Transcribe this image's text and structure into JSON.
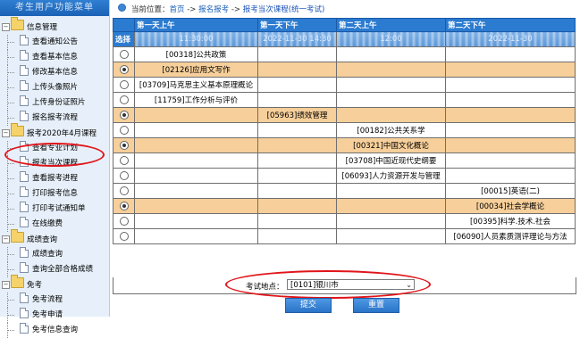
{
  "sidebar": {
    "title": "考生用户功能菜单",
    "groups": [
      {
        "label": "信息管理",
        "items": [
          "查看通知公告",
          "查看基本信息",
          "修改基本信息",
          "上传头像照片",
          "上传身份证照片",
          "报名报考流程"
        ]
      },
      {
        "label": "报考2020年4月课程",
        "items": [
          "查看专业计划",
          "报考当次课程",
          "查看报考进程",
          "打印报考信息",
          "打印考试通知单",
          "在线缴费"
        ]
      },
      {
        "label": "成绩查询",
        "items": [
          "成绩查询",
          "查询全部合格成绩"
        ]
      },
      {
        "label": "免考",
        "items": [
          "免考流程",
          "免考申请",
          "免考信息查询"
        ]
      }
    ],
    "toggle_symbol": "−"
  },
  "breadcrumb": {
    "prefix": "当前位置：",
    "home": "首页",
    "sep": " -> ",
    "level2": "报名报考",
    "current": "报考当次课程(统一考试)"
  },
  "table": {
    "headers": [
      "",
      "第一天上午",
      "第一天下午",
      "第二天上午",
      "第二天下午"
    ],
    "select_label": "选择",
    "blurred_times": [
      "11:30:00",
      "2022-11-30 14:30",
      "12:00",
      "2022-11-30"
    ],
    "rows": [
      {
        "checked": false,
        "highlight": false,
        "col": 1,
        "text": "[00318]公共政策"
      },
      {
        "checked": true,
        "highlight": true,
        "col": 1,
        "text": "[02126]应用文写作"
      },
      {
        "checked": false,
        "highlight": false,
        "col": 1,
        "text": "[03709]马克思主义基本原理概论"
      },
      {
        "checked": false,
        "highlight": false,
        "col": 1,
        "text": "[11759]工作分析与评价"
      },
      {
        "checked": true,
        "highlight": true,
        "col": 2,
        "text": "[05963]绩效管理"
      },
      {
        "checked": false,
        "highlight": false,
        "col": 3,
        "text": "[00182]公共关系学"
      },
      {
        "checked": true,
        "highlight": true,
        "col": 3,
        "text": "[00321]中国文化概论"
      },
      {
        "checked": false,
        "highlight": false,
        "col": 3,
        "text": "[03708]中国近现代史纲要"
      },
      {
        "checked": false,
        "highlight": false,
        "col": 3,
        "text": "[06093]人力资源开发与管理"
      },
      {
        "checked": false,
        "highlight": false,
        "col": 4,
        "text": "[00015]英语(二)"
      },
      {
        "checked": true,
        "highlight": true,
        "col": 4,
        "text": "[00034]社会学概论"
      },
      {
        "checked": false,
        "highlight": false,
        "col": 4,
        "text": "[00395]科学.技术.社会"
      },
      {
        "checked": false,
        "highlight": false,
        "col": 4,
        "text": "[06090]人员素质测评理论与方法"
      }
    ]
  },
  "location": {
    "label": "考试地点：",
    "selected": "[0101]银川市",
    "arrow": "⌄"
  },
  "buttons": {
    "submit": "提交",
    "reset": "重置"
  },
  "colors": {
    "header_blue": "#2b7bd0",
    "highlight_row": "#f6cf9a",
    "annotation_red": "#e0141a"
  }
}
